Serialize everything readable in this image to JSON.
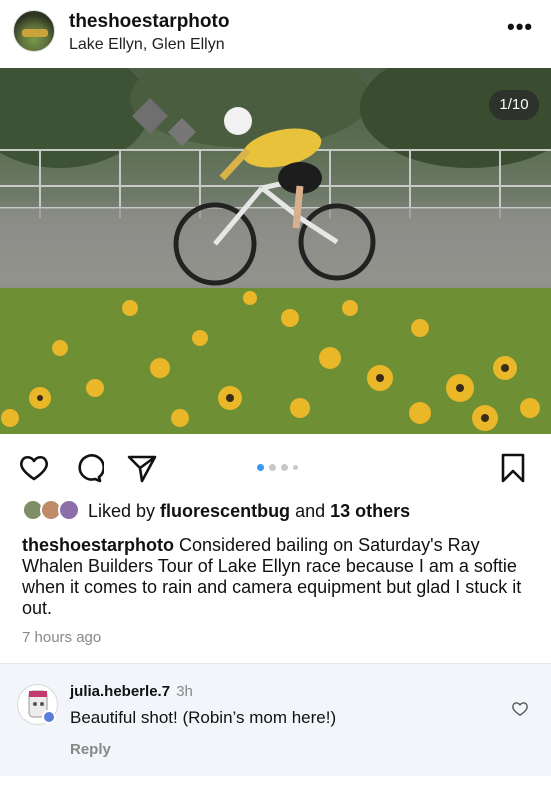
{
  "post": {
    "username": "theshoestarphoto",
    "location": "Lake Ellyn, Glen Ellyn",
    "more_label": "•••",
    "carousel_counter": "1/10",
    "carousel_pages": 10,
    "carousel_current": 1
  },
  "likes": {
    "prefix": "Liked by ",
    "first_user": "fluorescentbug",
    "middle": " and ",
    "others": "13 others"
  },
  "caption": {
    "username": "theshoestarphoto",
    "text": " Considered bailing on Saturday's Ray Whalen Builders Tour of Lake Ellyn race because I am a softie when it comes to rain and camera equipment but glad I stuck it out.",
    "time": "7 hours ago"
  },
  "comment": {
    "username": "julia.heberle.7",
    "time": "3h",
    "text": "Beautiful shot! (Robin’s mom here!)",
    "reply_label": "Reply"
  },
  "icons": {
    "like": "heart-icon",
    "comment": "comment-icon",
    "share": "send-icon",
    "save": "bookmark-icon"
  },
  "colors": {
    "accent": "#3897f0",
    "comment_bg": "#f2f6fa"
  }
}
